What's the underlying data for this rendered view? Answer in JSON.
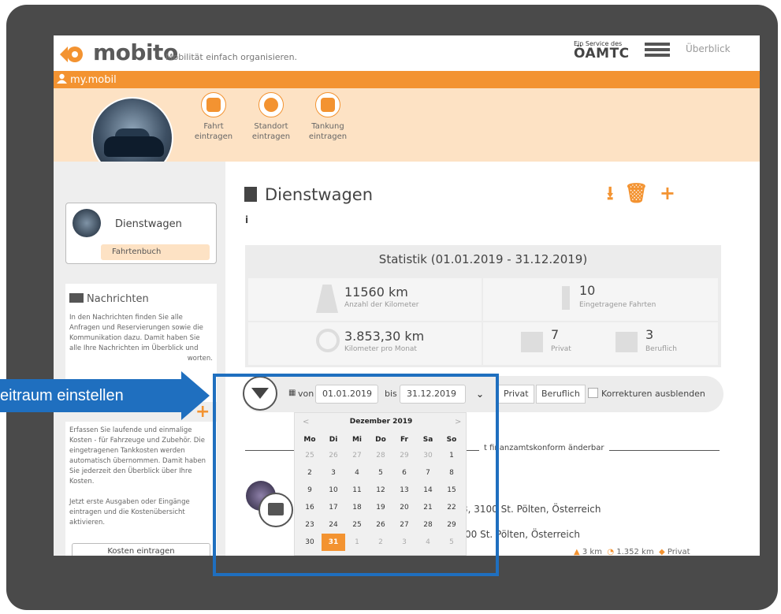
{
  "header": {
    "logo_text": "mobito",
    "tagline": "Mobilität einfach organisieren.",
    "oamtc_small": "Ein Service des",
    "oamtc": "ÖAMTC",
    "overview": "Überblick"
  },
  "nav_bar": {
    "label": "my.mobil"
  },
  "quick_actions": [
    {
      "line1": "Fahrt",
      "line2": "eintragen",
      "icon": "book-icon"
    },
    {
      "line1": "Standort",
      "line2": "eintragen",
      "icon": "crosshair-icon"
    },
    {
      "line1": "Tankung",
      "line2": "eintragen",
      "icon": "fuel-icon"
    }
  ],
  "sidebar": {
    "vehicle_name": "Dienstwagen",
    "vehicle_tag": "Fahrtenbuch",
    "messages_title": "Nachrichten",
    "messages_text": "In den Nachrichten finden Sie alle Anfragen und Reservierungen sowie die Kommunikation dazu. Damit haben Sie alle Ihre Nachrichten im Überblick und",
    "messages_tail": "worten.",
    "cost_text1": "Erfassen Sie laufende und einmalige Kosten - für Fahrzeuge und Zubehör. Die eingetragenen Tankkosten werden automatisch übernommen. Damit haben Sie jederzeit den Überblick über Ihre Kosten.",
    "cost_text2": "Jetzt erste Ausgaben oder Eingänge eintragen und die Kostenübersicht aktivieren.",
    "cost_button": "Kosten eintragen"
  },
  "main": {
    "title": "Dienstwagen",
    "info": "i",
    "stats_header": "Statistik (01.01.2019 - 31.12.2019)",
    "km_value": "11560 km",
    "km_label": "Anzahl der Kilometer",
    "trips_value": "10",
    "trips_label": "Eingetragene Fahrten",
    "avg_value": "3.853,30 km",
    "avg_label": "Kilometer pro Monat",
    "private_value": "7",
    "private_label": "Privat",
    "business_value": "3",
    "business_label": "Beruflich"
  },
  "filter": {
    "von_label": "von",
    "from_value": "01.01.2019",
    "bis_label": "bis",
    "to_value": "31.12.2019",
    "btn_private": "Privat",
    "btn_business": "Beruflich",
    "hide_corrections": "Korrekturen ausblenden"
  },
  "trips": {
    "separator_text": "t finanzamtskonform änderbar",
    "addr1": "3, 3100 St. Pölten, Österreich",
    "addr2": "00 St. Pölten, Österreich",
    "meta_km": "3 km",
    "meta_total": "1.352 km",
    "meta_type": "Privat"
  },
  "calendar": {
    "month": "Dezember 2019",
    "prev": "<",
    "next": ">",
    "weekdays": [
      "Mo",
      "Di",
      "Mi",
      "Do",
      "Fr",
      "Sa",
      "So"
    ],
    "weeks": [
      [
        "25",
        "26",
        "27",
        "28",
        "29",
        "30",
        "1"
      ],
      [
        "2",
        "3",
        "4",
        "5",
        "6",
        "7",
        "8"
      ],
      [
        "9",
        "10",
        "11",
        "12",
        "13",
        "14",
        "15"
      ],
      [
        "16",
        "17",
        "18",
        "19",
        "20",
        "21",
        "22"
      ],
      [
        "23",
        "24",
        "25",
        "26",
        "27",
        "28",
        "29"
      ],
      [
        "30",
        "31",
        "1",
        "2",
        "3",
        "4",
        "5"
      ]
    ],
    "selected": "31"
  },
  "callout": {
    "text": "eitraum einstellen"
  },
  "colors": {
    "accent": "#f39331",
    "highlight": "#1f6fbf",
    "frame": "#4a4a4a"
  }
}
